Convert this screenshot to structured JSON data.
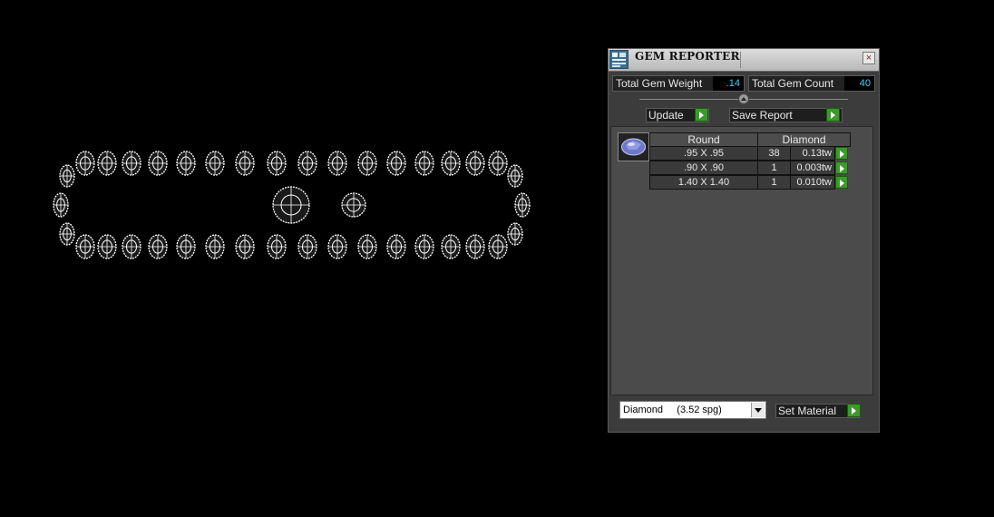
{
  "panel": {
    "title": "GEM REPORTER",
    "close_glyph": "×",
    "total_weight_label": "Total Gem Weight",
    "total_weight_value": ".14",
    "total_count_label": "Total Gem Count",
    "total_count_value": "40",
    "update_label": "Update",
    "save_report_label": "Save Report",
    "table": {
      "shape_header": "Round",
      "material_header": "Diamond",
      "rows": [
        {
          "size": ".95 X .95",
          "count": "38",
          "weight": "0.13tw"
        },
        {
          "size": ".90 X .90",
          "count": "1",
          "weight": "0.003tw"
        },
        {
          "size": "1.40 X 1.40",
          "count": "1",
          "weight": "0.010tw"
        }
      ]
    },
    "material_select": "Diamond     (3.52 spg)",
    "set_material_label": "Set Material"
  },
  "colors": {
    "value_text": "#3fd0ff",
    "arrow_green": "#3c9a2c",
    "gem_wireframe": "#ffffff"
  },
  "icons": {
    "app": "gem-reporter-icon",
    "close": "close-icon",
    "arrow": "green-play-arrow-icon",
    "thumb": "round-gem-icon",
    "dropdown": "chevron-down-icon"
  }
}
